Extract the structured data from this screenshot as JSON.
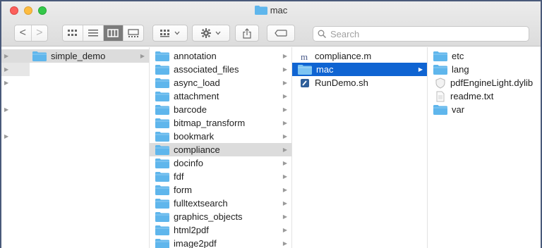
{
  "window": {
    "title": "mac"
  },
  "toolbar": {
    "back_label": "<",
    "forward_label": ">",
    "search_placeholder": "Search"
  },
  "columns": [
    {
      "items": [
        {
          "name": "simple_demo",
          "kind": "folder",
          "selected": "grey",
          "arrow": true
        }
      ]
    },
    {
      "items": [
        {
          "name": "annotation",
          "kind": "folder",
          "arrow": true
        },
        {
          "name": "associated_files",
          "kind": "folder",
          "arrow": true
        },
        {
          "name": "async_load",
          "kind": "folder",
          "arrow": true
        },
        {
          "name": "attachment",
          "kind": "folder",
          "arrow": true
        },
        {
          "name": "barcode",
          "kind": "folder",
          "arrow": true
        },
        {
          "name": "bitmap_transform",
          "kind": "folder",
          "arrow": true
        },
        {
          "name": "bookmark",
          "kind": "folder",
          "arrow": true
        },
        {
          "name": "compliance",
          "kind": "folder",
          "selected": "grey",
          "arrow": true
        },
        {
          "name": "docinfo",
          "kind": "folder",
          "arrow": true
        },
        {
          "name": "fdf",
          "kind": "folder",
          "arrow": true
        },
        {
          "name": "form",
          "kind": "folder",
          "arrow": true
        },
        {
          "name": "fulltextsearch",
          "kind": "folder",
          "arrow": true
        },
        {
          "name": "graphics_objects",
          "kind": "folder",
          "arrow": true
        },
        {
          "name": "html2pdf",
          "kind": "folder",
          "arrow": true
        },
        {
          "name": "image2pdf",
          "kind": "folder",
          "arrow": true
        }
      ]
    },
    {
      "items": [
        {
          "name": "compliance.m",
          "kind": "m-file"
        },
        {
          "name": "mac",
          "kind": "folder",
          "selected": "blue",
          "arrow": true
        },
        {
          "name": "RunDemo.sh",
          "kind": "shell-script"
        }
      ]
    },
    {
      "items": [
        {
          "name": "etc",
          "kind": "folder"
        },
        {
          "name": "lang",
          "kind": "folder"
        },
        {
          "name": "pdfEngineLight.dylib",
          "kind": "dylib"
        },
        {
          "name": "readme.txt",
          "kind": "text"
        },
        {
          "name": "var",
          "kind": "folder"
        }
      ]
    }
  ],
  "colors": {
    "selection_blue": "#0f64d2",
    "selection_grey": "#dcdcdc",
    "folder_blue": "#5fb6ec"
  }
}
